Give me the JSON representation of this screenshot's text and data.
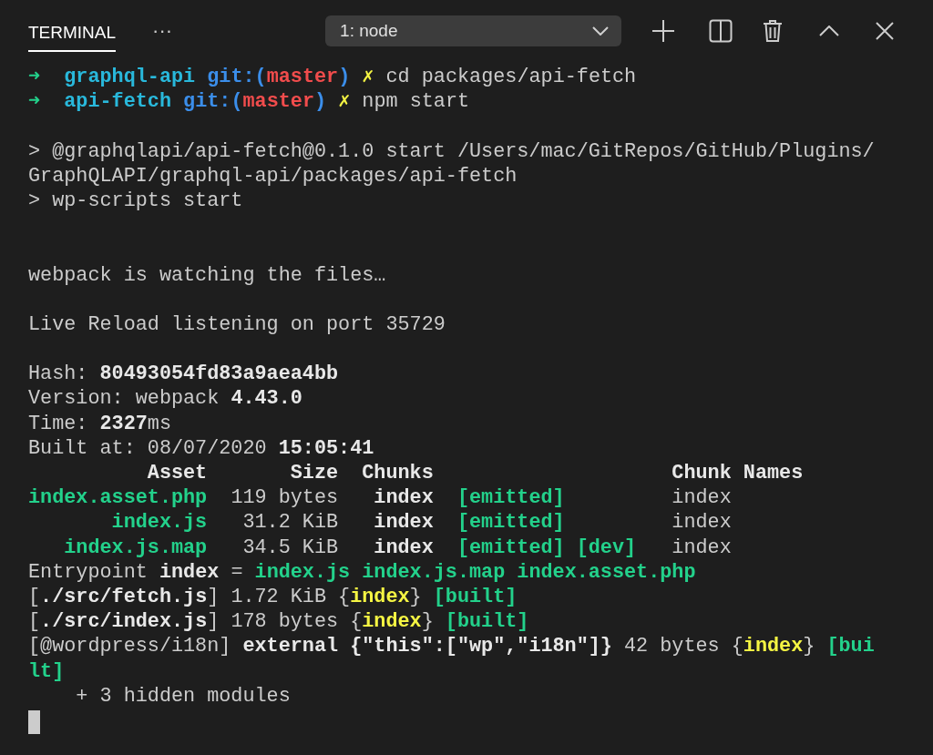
{
  "panel": {
    "tab": {
      "label": "TERMINAL",
      "selected": true
    },
    "more": "···",
    "terminal_select": {
      "value": "1: node"
    }
  },
  "terminal_lines": [
    {
      "kind": "text",
      "segments": [
        {
          "kind": "green-bold",
          "text": "➜"
        },
        {
          "kind": "cyan-bold",
          "text": "  graphql-api"
        },
        {
          "kind": "blue-bold",
          "text": " git:("
        },
        {
          "kind": "red-bold",
          "text": "master"
        },
        {
          "kind": "blue-bold",
          "text": ")"
        },
        {
          "kind": "yellow",
          "text": " ✗"
        },
        {
          "kind": "plain",
          "text": " cd packages/api-fetch"
        }
      ]
    },
    {
      "kind": "text",
      "segments": [
        {
          "kind": "green-bold",
          "text": "➜"
        },
        {
          "kind": "cyan-bold",
          "text": "  api-fetch"
        },
        {
          "kind": "blue-bold",
          "text": " git:("
        },
        {
          "kind": "red-bold",
          "text": "master"
        },
        {
          "kind": "blue-bold",
          "text": ")"
        },
        {
          "kind": "yellow",
          "text": " ✗"
        },
        {
          "kind": "plain",
          "text": " npm start"
        }
      ]
    },
    {
      "kind": "blank"
    },
    {
      "kind": "text",
      "segments": [
        {
          "kind": "plain",
          "text": "> @graphqlapi/api-fetch@0.1.0 start /Users/mac/GitRepos/GitHub/Plugins/"
        }
      ]
    },
    {
      "kind": "text",
      "segments": [
        {
          "kind": "plain",
          "text": "GraphQLAPI/graphql-api/packages/api-fetch"
        }
      ]
    },
    {
      "kind": "text",
      "segments": [
        {
          "kind": "plain",
          "text": "> wp-scripts start"
        }
      ]
    },
    {
      "kind": "blank"
    },
    {
      "kind": "blank"
    },
    {
      "kind": "text",
      "segments": [
        {
          "kind": "plain",
          "text": "webpack is watching the files…"
        }
      ]
    },
    {
      "kind": "blank"
    },
    {
      "kind": "text",
      "segments": [
        {
          "kind": "plain",
          "text": "Live Reload listening on port 35729"
        }
      ]
    },
    {
      "kind": "blank"
    },
    {
      "kind": "text",
      "segments": [
        {
          "kind": "plain",
          "text": "Hash: "
        },
        {
          "kind": "bold",
          "text": "80493054fd83a9aea4bb"
        }
      ]
    },
    {
      "kind": "text",
      "segments": [
        {
          "kind": "plain",
          "text": "Version: webpack "
        },
        {
          "kind": "bold",
          "text": "4.43.0"
        }
      ]
    },
    {
      "kind": "text",
      "segments": [
        {
          "kind": "plain",
          "text": "Time: "
        },
        {
          "kind": "bold",
          "text": "2327"
        },
        {
          "kind": "plain",
          "text": "ms"
        }
      ]
    },
    {
      "kind": "text",
      "segments": [
        {
          "kind": "plain",
          "text": "Built at: 08/07/2020 "
        },
        {
          "kind": "bold",
          "text": "15:05:41"
        }
      ]
    },
    {
      "kind": "text",
      "segments": [
        {
          "kind": "bold",
          "text": "          Asset       Size  Chunks                    Chunk Names"
        }
      ]
    },
    {
      "kind": "text",
      "segments": [
        {
          "kind": "green-bold",
          "text": "index.asset.php"
        },
        {
          "kind": "plain",
          "text": "  119 bytes   "
        },
        {
          "kind": "bold",
          "text": "index"
        },
        {
          "kind": "green-bold",
          "text": "  [emitted]"
        },
        {
          "kind": "plain",
          "text": "         index"
        }
      ]
    },
    {
      "kind": "text",
      "segments": [
        {
          "kind": "green-bold",
          "text": "       index.js"
        },
        {
          "kind": "plain",
          "text": "   31.2 KiB   "
        },
        {
          "kind": "bold",
          "text": "index"
        },
        {
          "kind": "green-bold",
          "text": "  [emitted]"
        },
        {
          "kind": "plain",
          "text": "         index"
        }
      ]
    },
    {
      "kind": "text",
      "segments": [
        {
          "kind": "green-bold",
          "text": "   index.js.map"
        },
        {
          "kind": "plain",
          "text": "   34.5 KiB   "
        },
        {
          "kind": "bold",
          "text": "index"
        },
        {
          "kind": "green-bold",
          "text": "  [emitted] [dev]"
        },
        {
          "kind": "plain",
          "text": "   index"
        }
      ]
    },
    {
      "kind": "text",
      "segments": [
        {
          "kind": "plain",
          "text": "Entrypoint "
        },
        {
          "kind": "bold",
          "text": "index"
        },
        {
          "kind": "plain",
          "text": " = "
        },
        {
          "kind": "green-bold",
          "text": "index.js index.js.map index.asset.php"
        }
      ]
    },
    {
      "kind": "text",
      "segments": [
        {
          "kind": "plain",
          "text": "["
        },
        {
          "kind": "bold",
          "text": "./src/fetch.js"
        },
        {
          "kind": "plain",
          "text": "] 1.72 KiB {"
        },
        {
          "kind": "yellow-bold",
          "text": "index"
        },
        {
          "kind": "plain",
          "text": "} "
        },
        {
          "kind": "green-bold",
          "text": "[built]"
        }
      ]
    },
    {
      "kind": "text",
      "segments": [
        {
          "kind": "plain",
          "text": "["
        },
        {
          "kind": "bold",
          "text": "./src/index.js"
        },
        {
          "kind": "plain",
          "text": "] 178 bytes {"
        },
        {
          "kind": "yellow-bold",
          "text": "index"
        },
        {
          "kind": "plain",
          "text": "} "
        },
        {
          "kind": "green-bold",
          "text": "[built]"
        }
      ]
    },
    {
      "kind": "text",
      "segments": [
        {
          "kind": "plain",
          "text": "[@wordpress/i18n] "
        },
        {
          "kind": "bold",
          "text": "external {\"this\":[\"wp\",\"i18n\"]}"
        },
        {
          "kind": "plain",
          "text": " 42 bytes {"
        },
        {
          "kind": "yellow-bold",
          "text": "index"
        },
        {
          "kind": "plain",
          "text": "} "
        },
        {
          "kind": "green-bold",
          "text": "[bui"
        }
      ]
    },
    {
      "kind": "text",
      "segments": [
        {
          "kind": "green-bold",
          "text": "lt]"
        }
      ]
    },
    {
      "kind": "text",
      "segments": [
        {
          "kind": "plain",
          "text": "    + 3 hidden modules"
        }
      ]
    },
    {
      "kind": "cursor"
    }
  ]
}
